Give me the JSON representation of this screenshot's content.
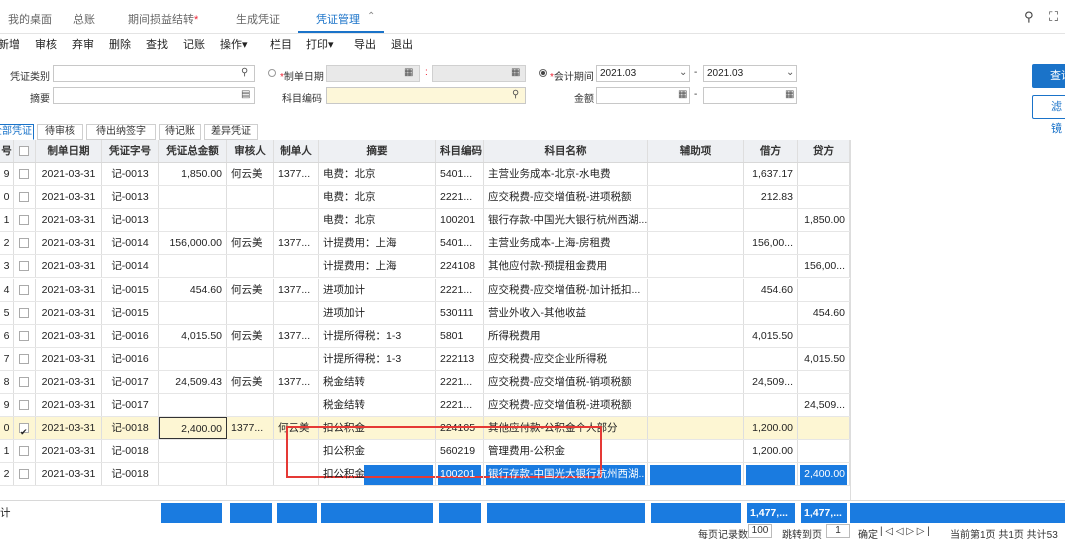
{
  "tabs": [
    {
      "label": "我的桌面"
    },
    {
      "label": "总账"
    },
    {
      "label": "期间损益结转",
      "star": "*"
    },
    {
      "label": "生成凭证"
    },
    {
      "label": "凭证管理"
    }
  ],
  "tab_close": "⌃",
  "toolbar": [
    "新增",
    "审核",
    "弃审",
    "删除",
    "查找",
    "记账",
    "操作▾",
    "栏目",
    "打印▾",
    "导出",
    "退出"
  ],
  "filters": {
    "voucher_type_label": "凭证类别",
    "summary_label": "摘要",
    "date_label": "制单日期",
    "account_label": "科目编码",
    "period_label": "会计期间",
    "period_from": "2021.03",
    "period_to": "2021.03",
    "amount_label": "金额",
    "dash": "-",
    "colon": ":"
  },
  "buttons": {
    "query": "查询",
    "filter": "滤镜"
  },
  "subtabs": [
    "全部凭证",
    "待审核",
    "待出纳签字",
    "待记账",
    "差异凭证"
  ],
  "columns": [
    "号",
    "",
    "制单日期",
    "凭证字号",
    "凭证总金额",
    "审核人",
    "制单人",
    "摘要",
    "科目编码",
    "科目名称",
    "辅助项",
    "借方",
    "贷方"
  ],
  "rows": [
    {
      "no": "9",
      "checked": false,
      "date": "2021-03-31",
      "voucher": "记-0013",
      "total": "1,850.00",
      "auditor": "何云美",
      "maker": "1377...",
      "summary": "电费：北京",
      "code": "5401...",
      "name": "主营业务成本-北京-水电费",
      "aux": "",
      "debit": "1,637.17",
      "credit": ""
    },
    {
      "no": "0",
      "checked": false,
      "date": "2021-03-31",
      "voucher": "记-0013",
      "total": "",
      "auditor": "",
      "maker": "",
      "summary": "电费：北京",
      "code": "2221...",
      "name": "应交税费-应交增值税-进项税额",
      "aux": "",
      "debit": "212.83",
      "credit": ""
    },
    {
      "no": "1",
      "checked": false,
      "date": "2021-03-31",
      "voucher": "记-0013",
      "total": "",
      "auditor": "",
      "maker": "",
      "summary": "电费：北京",
      "code": "100201",
      "name": "银行存款-中国光大银行杭州西湖...",
      "aux": "",
      "debit": "",
      "credit": "1,850.00"
    },
    {
      "no": "2",
      "checked": false,
      "date": "2021-03-31",
      "voucher": "记-0014",
      "total": "156,000.00",
      "auditor": "何云美",
      "maker": "1377...",
      "summary": "计提费用：上海",
      "code": "5401...",
      "name": "主营业务成本-上海-房租费",
      "aux": "",
      "debit": "156,00...",
      "credit": ""
    },
    {
      "no": "3",
      "checked": false,
      "date": "2021-03-31",
      "voucher": "记-0014",
      "total": "",
      "auditor": "",
      "maker": "",
      "summary": "计提费用：上海",
      "code": "224108",
      "name": "其他应付款-预提租金费用",
      "aux": "",
      "debit": "",
      "credit": "156,00..."
    },
    {
      "no": "4",
      "checked": false,
      "date": "2021-03-31",
      "voucher": "记-0015",
      "total": "454.60",
      "auditor": "何云美",
      "maker": "1377...",
      "summary": "进项加计",
      "code": "2221...",
      "name": "应交税费-应交增值税-加计抵扣...",
      "aux": "",
      "debit": "454.60",
      "credit": ""
    },
    {
      "no": "5",
      "checked": false,
      "date": "2021-03-31",
      "voucher": "记-0015",
      "total": "",
      "auditor": "",
      "maker": "",
      "summary": "进项加计",
      "code": "530111",
      "name": "营业外收入-其他收益",
      "aux": "",
      "debit": "",
      "credit": "454.60"
    },
    {
      "no": "6",
      "checked": false,
      "date": "2021-03-31",
      "voucher": "记-0016",
      "total": "4,015.50",
      "auditor": "何云美",
      "maker": "1377...",
      "summary": "计提所得税：1-3",
      "code": "5801",
      "name": "所得税费用",
      "aux": "",
      "debit": "4,015.50",
      "credit": ""
    },
    {
      "no": "7",
      "checked": false,
      "date": "2021-03-31",
      "voucher": "记-0016",
      "total": "",
      "auditor": "",
      "maker": "",
      "summary": "计提所得税：1-3",
      "code": "222113",
      "name": "应交税费-应交企业所得税",
      "aux": "",
      "debit": "",
      "credit": "4,015.50"
    },
    {
      "no": "8",
      "checked": false,
      "date": "2021-03-31",
      "voucher": "记-0017",
      "total": "24,509.43",
      "auditor": "何云美",
      "maker": "1377...",
      "summary": "税金结转",
      "code": "2221...",
      "name": "应交税费-应交增值税-销项税额",
      "aux": "",
      "debit": "24,509...",
      "credit": ""
    },
    {
      "no": "9",
      "checked": false,
      "date": "2021-03-31",
      "voucher": "记-0017",
      "total": "",
      "auditor": "",
      "maker": "",
      "summary": "税金结转",
      "code": "2221...",
      "name": "应交税费-应交增值税-进项税额",
      "aux": "",
      "debit": "",
      "credit": "24,509..."
    },
    {
      "no": "0",
      "checked": true,
      "date": "2021-03-31",
      "voucher": "记-0018",
      "total": "2,400.00",
      "auditor": "1377...",
      "maker": "何云美",
      "summary": "扣公积金",
      "code": "224105",
      "name": "其他应付款-公积金个人部分",
      "aux": "",
      "debit": "1,200.00",
      "credit": ""
    },
    {
      "no": "1",
      "checked": false,
      "date": "2021-03-31",
      "voucher": "记-0018",
      "total": "",
      "auditor": "",
      "maker": "",
      "summary": "扣公积金",
      "code": "560219",
      "name": "管理费用-公积金",
      "aux": "",
      "debit": "1,200.00",
      "credit": ""
    },
    {
      "no": "2",
      "checked": false,
      "date": "2021-03-31",
      "voucher": "记-0018",
      "total": "",
      "auditor": "",
      "maker": "",
      "summary": "扣公积金",
      "code": "100201",
      "name": "银行存款-中国光大银行杭州西湖...",
      "aux": "",
      "debit": "",
      "credit": "2,400.00"
    }
  ],
  "total_row": {
    "label": "计",
    "debit": "1,477,...",
    "credit": "1,477,..."
  },
  "footer": {
    "per_page_label": "每页记录数",
    "per_page": "100",
    "jump_label": "跳转到页",
    "jump": "1",
    "confirm": "确定",
    "nav": "| ◁ ◁ ▷ ▷ |",
    "page_info": "当前第1页 共1页 共计53"
  },
  "colors": {
    "accent": "#1a73c9",
    "highlight": "#1a7be0",
    "selected_row": "#fdf6d3",
    "annotation": "#e53935"
  }
}
